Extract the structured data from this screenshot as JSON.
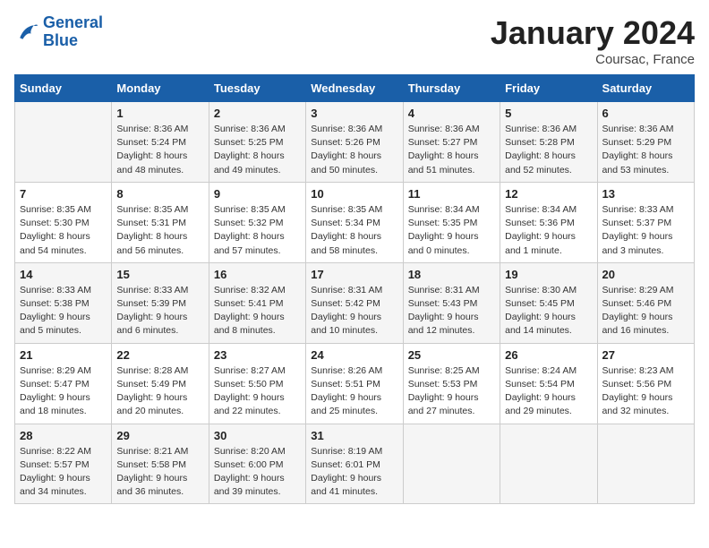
{
  "logo": {
    "text_general": "General",
    "text_blue": "Blue"
  },
  "title": "January 2024",
  "location": "Coursac, France",
  "days_of_week": [
    "Sunday",
    "Monday",
    "Tuesday",
    "Wednesday",
    "Thursday",
    "Friday",
    "Saturday"
  ],
  "weeks": [
    [
      {
        "day": "",
        "sunrise": "",
        "sunset": "",
        "daylight": ""
      },
      {
        "day": "1",
        "sunrise": "Sunrise: 8:36 AM",
        "sunset": "Sunset: 5:24 PM",
        "daylight": "Daylight: 8 hours and 48 minutes."
      },
      {
        "day": "2",
        "sunrise": "Sunrise: 8:36 AM",
        "sunset": "Sunset: 5:25 PM",
        "daylight": "Daylight: 8 hours and 49 minutes."
      },
      {
        "day": "3",
        "sunrise": "Sunrise: 8:36 AM",
        "sunset": "Sunset: 5:26 PM",
        "daylight": "Daylight: 8 hours and 50 minutes."
      },
      {
        "day": "4",
        "sunrise": "Sunrise: 8:36 AM",
        "sunset": "Sunset: 5:27 PM",
        "daylight": "Daylight: 8 hours and 51 minutes."
      },
      {
        "day": "5",
        "sunrise": "Sunrise: 8:36 AM",
        "sunset": "Sunset: 5:28 PM",
        "daylight": "Daylight: 8 hours and 52 minutes."
      },
      {
        "day": "6",
        "sunrise": "Sunrise: 8:36 AM",
        "sunset": "Sunset: 5:29 PM",
        "daylight": "Daylight: 8 hours and 53 minutes."
      }
    ],
    [
      {
        "day": "7",
        "sunrise": "Sunrise: 8:35 AM",
        "sunset": "Sunset: 5:30 PM",
        "daylight": "Daylight: 8 hours and 54 minutes."
      },
      {
        "day": "8",
        "sunrise": "Sunrise: 8:35 AM",
        "sunset": "Sunset: 5:31 PM",
        "daylight": "Daylight: 8 hours and 56 minutes."
      },
      {
        "day": "9",
        "sunrise": "Sunrise: 8:35 AM",
        "sunset": "Sunset: 5:32 PM",
        "daylight": "Daylight: 8 hours and 57 minutes."
      },
      {
        "day": "10",
        "sunrise": "Sunrise: 8:35 AM",
        "sunset": "Sunset: 5:34 PM",
        "daylight": "Daylight: 8 hours and 58 minutes."
      },
      {
        "day": "11",
        "sunrise": "Sunrise: 8:34 AM",
        "sunset": "Sunset: 5:35 PM",
        "daylight": "Daylight: 9 hours and 0 minutes."
      },
      {
        "day": "12",
        "sunrise": "Sunrise: 8:34 AM",
        "sunset": "Sunset: 5:36 PM",
        "daylight": "Daylight: 9 hours and 1 minute."
      },
      {
        "day": "13",
        "sunrise": "Sunrise: 8:33 AM",
        "sunset": "Sunset: 5:37 PM",
        "daylight": "Daylight: 9 hours and 3 minutes."
      }
    ],
    [
      {
        "day": "14",
        "sunrise": "Sunrise: 8:33 AM",
        "sunset": "Sunset: 5:38 PM",
        "daylight": "Daylight: 9 hours and 5 minutes."
      },
      {
        "day": "15",
        "sunrise": "Sunrise: 8:33 AM",
        "sunset": "Sunset: 5:39 PM",
        "daylight": "Daylight: 9 hours and 6 minutes."
      },
      {
        "day": "16",
        "sunrise": "Sunrise: 8:32 AM",
        "sunset": "Sunset: 5:41 PM",
        "daylight": "Daylight: 9 hours and 8 minutes."
      },
      {
        "day": "17",
        "sunrise": "Sunrise: 8:31 AM",
        "sunset": "Sunset: 5:42 PM",
        "daylight": "Daylight: 9 hours and 10 minutes."
      },
      {
        "day": "18",
        "sunrise": "Sunrise: 8:31 AM",
        "sunset": "Sunset: 5:43 PM",
        "daylight": "Daylight: 9 hours and 12 minutes."
      },
      {
        "day": "19",
        "sunrise": "Sunrise: 8:30 AM",
        "sunset": "Sunset: 5:45 PM",
        "daylight": "Daylight: 9 hours and 14 minutes."
      },
      {
        "day": "20",
        "sunrise": "Sunrise: 8:29 AM",
        "sunset": "Sunset: 5:46 PM",
        "daylight": "Daylight: 9 hours and 16 minutes."
      }
    ],
    [
      {
        "day": "21",
        "sunrise": "Sunrise: 8:29 AM",
        "sunset": "Sunset: 5:47 PM",
        "daylight": "Daylight: 9 hours and 18 minutes."
      },
      {
        "day": "22",
        "sunrise": "Sunrise: 8:28 AM",
        "sunset": "Sunset: 5:49 PM",
        "daylight": "Daylight: 9 hours and 20 minutes."
      },
      {
        "day": "23",
        "sunrise": "Sunrise: 8:27 AM",
        "sunset": "Sunset: 5:50 PM",
        "daylight": "Daylight: 9 hours and 22 minutes."
      },
      {
        "day": "24",
        "sunrise": "Sunrise: 8:26 AM",
        "sunset": "Sunset: 5:51 PM",
        "daylight": "Daylight: 9 hours and 25 minutes."
      },
      {
        "day": "25",
        "sunrise": "Sunrise: 8:25 AM",
        "sunset": "Sunset: 5:53 PM",
        "daylight": "Daylight: 9 hours and 27 minutes."
      },
      {
        "day": "26",
        "sunrise": "Sunrise: 8:24 AM",
        "sunset": "Sunset: 5:54 PM",
        "daylight": "Daylight: 9 hours and 29 minutes."
      },
      {
        "day": "27",
        "sunrise": "Sunrise: 8:23 AM",
        "sunset": "Sunset: 5:56 PM",
        "daylight": "Daylight: 9 hours and 32 minutes."
      }
    ],
    [
      {
        "day": "28",
        "sunrise": "Sunrise: 8:22 AM",
        "sunset": "Sunset: 5:57 PM",
        "daylight": "Daylight: 9 hours and 34 minutes."
      },
      {
        "day": "29",
        "sunrise": "Sunrise: 8:21 AM",
        "sunset": "Sunset: 5:58 PM",
        "daylight": "Daylight: 9 hours and 36 minutes."
      },
      {
        "day": "30",
        "sunrise": "Sunrise: 8:20 AM",
        "sunset": "Sunset: 6:00 PM",
        "daylight": "Daylight: 9 hours and 39 minutes."
      },
      {
        "day": "31",
        "sunrise": "Sunrise: 8:19 AM",
        "sunset": "Sunset: 6:01 PM",
        "daylight": "Daylight: 9 hours and 41 minutes."
      },
      {
        "day": "",
        "sunrise": "",
        "sunset": "",
        "daylight": ""
      },
      {
        "day": "",
        "sunrise": "",
        "sunset": "",
        "daylight": ""
      },
      {
        "day": "",
        "sunrise": "",
        "sunset": "",
        "daylight": ""
      }
    ]
  ]
}
